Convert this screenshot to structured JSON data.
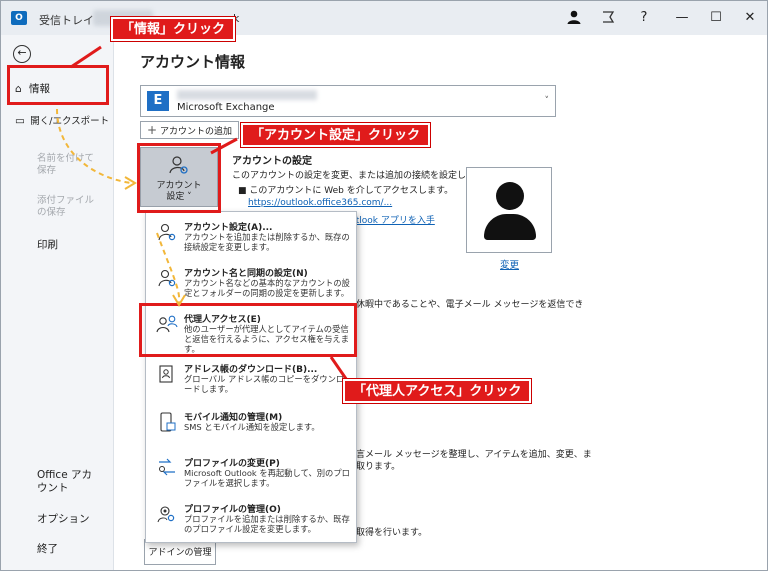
{
  "titlebar": {
    "app_icon": "O",
    "title": "受信トレイ -",
    "title_tail": "k",
    "icons": [
      "person-icon",
      "sparkle-icon",
      "help-icon",
      "minimize-icon",
      "maximize-icon",
      "close-icon"
    ],
    "help": "?",
    "minimize": "—",
    "maximize": "☐",
    "close": "✕"
  },
  "nav": {
    "back": "←",
    "items": [
      {
        "label": "情報",
        "icon": "home-icon"
      },
      {
        "label": "開く/エクスポート",
        "icon": "folder-open-icon"
      },
      {
        "label": "名前を付けて保存",
        "disabled": true
      },
      {
        "label": "添付ファイルの保存",
        "disabled": true
      },
      {
        "label": "印刷"
      },
      {
        "label": "Office アカウント"
      },
      {
        "label": "オプション"
      },
      {
        "label": "終了"
      }
    ]
  },
  "main": {
    "heading": "アカウント情報",
    "account_type": "Microsoft Exchange",
    "add_account": "アカウントの追加",
    "settings_tile": {
      "line1": "アカウント",
      "line2": "設定 ˅"
    },
    "section_heading": "アカウントの設定",
    "section_desc": "このアカウントの設定を変更、または追加の接続を設定します。",
    "bullet_text": "このアカウントに Web を介してアクセスします。",
    "owa_link": "https://outlook.office365.com/...",
    "mobile_link": "utlook アプリを入手",
    "change_link": "変更",
    "ooo_text": "休暇中であることや、電子メール メッセージを返信でき",
    "cleanup_text": "言メール メッセージを整理し、アイテムを追加、変更、ま",
    "cleanup_text2": "取ります。",
    "rules_text": "取得を行います。",
    "addin_button": "アドインの管理"
  },
  "menu": [
    {
      "title": "アカウント設定(A)...",
      "desc": "アカウントを追加または削除するか、既存の接続設定を変更します。",
      "icon": "account-settings-icon"
    },
    {
      "title": "アカウント名と同期の設定(N)",
      "desc": "アカウント名などの基本的なアカウントの設定とフォルダーの同期の設定を更新します。",
      "icon": "account-sync-icon"
    },
    {
      "title": "代理人アクセス(E)",
      "desc": "他のユーザーが代理人としてアイテムの受信と返信を行えるように、アクセス権を与えます。",
      "icon": "delegate-icon"
    },
    {
      "title": "アドレス帳のダウンロード(B)...",
      "desc": "グローバル アドレス帳のコピーをダウンロードします。",
      "icon": "address-book-icon"
    },
    {
      "title": "モバイル通知の管理(M)",
      "desc": "SMS とモバイル通知を設定します。",
      "icon": "mobile-icon"
    },
    {
      "title": "プロファイルの変更(P)",
      "desc": "Microsoft Outlook を再起動して、別のプロファイルを選択します。",
      "icon": "profile-switch-icon"
    },
    {
      "title": "プロファイルの管理(O)",
      "desc": "プロファイルを追加または削除するか、既存のプロファイル設定を変更します。",
      "icon": "profile-manage-icon"
    }
  ],
  "callouts": {
    "info": "「情報」クリック",
    "account_settings": "「アカウント設定」クリック",
    "delegate": "「代理人アクセス」クリック"
  },
  "colors": {
    "highlight": "#e01b1b",
    "arrow": "#f2b73a",
    "link": "#0f62b5"
  }
}
